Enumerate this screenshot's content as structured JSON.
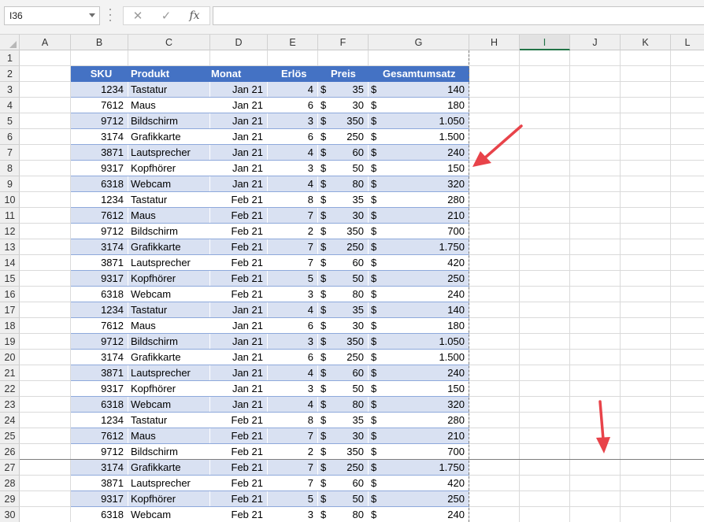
{
  "name_box": "I36",
  "formula": "",
  "columns": [
    "A",
    "B",
    "C",
    "D",
    "E",
    "F",
    "G",
    "H",
    "I",
    "J",
    "K",
    "L"
  ],
  "selected_column": "I",
  "rows": [
    "1",
    "2",
    "3",
    "4",
    "5",
    "6",
    "7",
    "8",
    "9",
    "10",
    "11",
    "12",
    "13",
    "14",
    "15",
    "16",
    "17",
    "18",
    "19",
    "20",
    "21",
    "22",
    "23",
    "24",
    "25",
    "26",
    "27",
    "28",
    "29",
    "30"
  ],
  "table": {
    "headers": [
      "SKU",
      "Produkt",
      "Monat",
      "Erlös",
      "Preis",
      "Gesamtumsatz"
    ],
    "currency": "$",
    "rows": [
      [
        "1234",
        "Tastatur",
        "Jan 21",
        "4",
        "35",
        "140"
      ],
      [
        "7612",
        "Maus",
        "Jan 21",
        "6",
        "30",
        "180"
      ],
      [
        "9712",
        "Bildschirm",
        "Jan 21",
        "3",
        "350",
        "1.050"
      ],
      [
        "3174",
        "Grafikkarte",
        "Jan 21",
        "6",
        "250",
        "1.500"
      ],
      [
        "3871",
        "Lautsprecher",
        "Jan 21",
        "4",
        "60",
        "240"
      ],
      [
        "9317",
        "Kopfhörer",
        "Jan 21",
        "3",
        "50",
        "150"
      ],
      [
        "6318",
        "Webcam",
        "Jan 21",
        "4",
        "80",
        "320"
      ],
      [
        "1234",
        "Tastatur",
        "Feb 21",
        "8",
        "35",
        "280"
      ],
      [
        "7612",
        "Maus",
        "Feb 21",
        "7",
        "30",
        "210"
      ],
      [
        "9712",
        "Bildschirm",
        "Feb 21",
        "2",
        "350",
        "700"
      ],
      [
        "3174",
        "Grafikkarte",
        "Feb 21",
        "7",
        "250",
        "1.750"
      ],
      [
        "3871",
        "Lautsprecher",
        "Feb 21",
        "7",
        "60",
        "420"
      ],
      [
        "9317",
        "Kopfhörer",
        "Feb 21",
        "5",
        "50",
        "250"
      ],
      [
        "6318",
        "Webcam",
        "Feb 21",
        "3",
        "80",
        "240"
      ],
      [
        "1234",
        "Tastatur",
        "Jan 21",
        "4",
        "35",
        "140"
      ],
      [
        "7612",
        "Maus",
        "Jan 21",
        "6",
        "30",
        "180"
      ],
      [
        "9712",
        "Bildschirm",
        "Jan 21",
        "3",
        "350",
        "1.050"
      ],
      [
        "3174",
        "Grafikkarte",
        "Jan 21",
        "6",
        "250",
        "1.500"
      ],
      [
        "3871",
        "Lautsprecher",
        "Jan 21",
        "4",
        "60",
        "240"
      ],
      [
        "9317",
        "Kopfhörer",
        "Jan 21",
        "3",
        "50",
        "150"
      ],
      [
        "6318",
        "Webcam",
        "Jan 21",
        "4",
        "80",
        "320"
      ],
      [
        "1234",
        "Tastatur",
        "Feb 21",
        "8",
        "35",
        "280"
      ],
      [
        "7612",
        "Maus",
        "Feb 21",
        "7",
        "30",
        "210"
      ],
      [
        "9712",
        "Bildschirm",
        "Feb 21",
        "2",
        "350",
        "700"
      ],
      [
        "3174",
        "Grafikkarte",
        "Feb 21",
        "7",
        "250",
        "1.750"
      ],
      [
        "3871",
        "Lautsprecher",
        "Feb 21",
        "7",
        "60",
        "420"
      ],
      [
        "9317",
        "Kopfhörer",
        "Feb 21",
        "5",
        "50",
        "250"
      ],
      [
        "6318",
        "Webcam",
        "Feb 21",
        "3",
        "80",
        "240"
      ]
    ]
  },
  "colors": {
    "header_fill": "#4472c4",
    "band_fill": "#d9e1f2",
    "arrow": "#e8434a",
    "selection": "#217346"
  },
  "icons": {
    "cancel": "x-icon",
    "enter": "check-icon",
    "function": "fx-icon"
  }
}
